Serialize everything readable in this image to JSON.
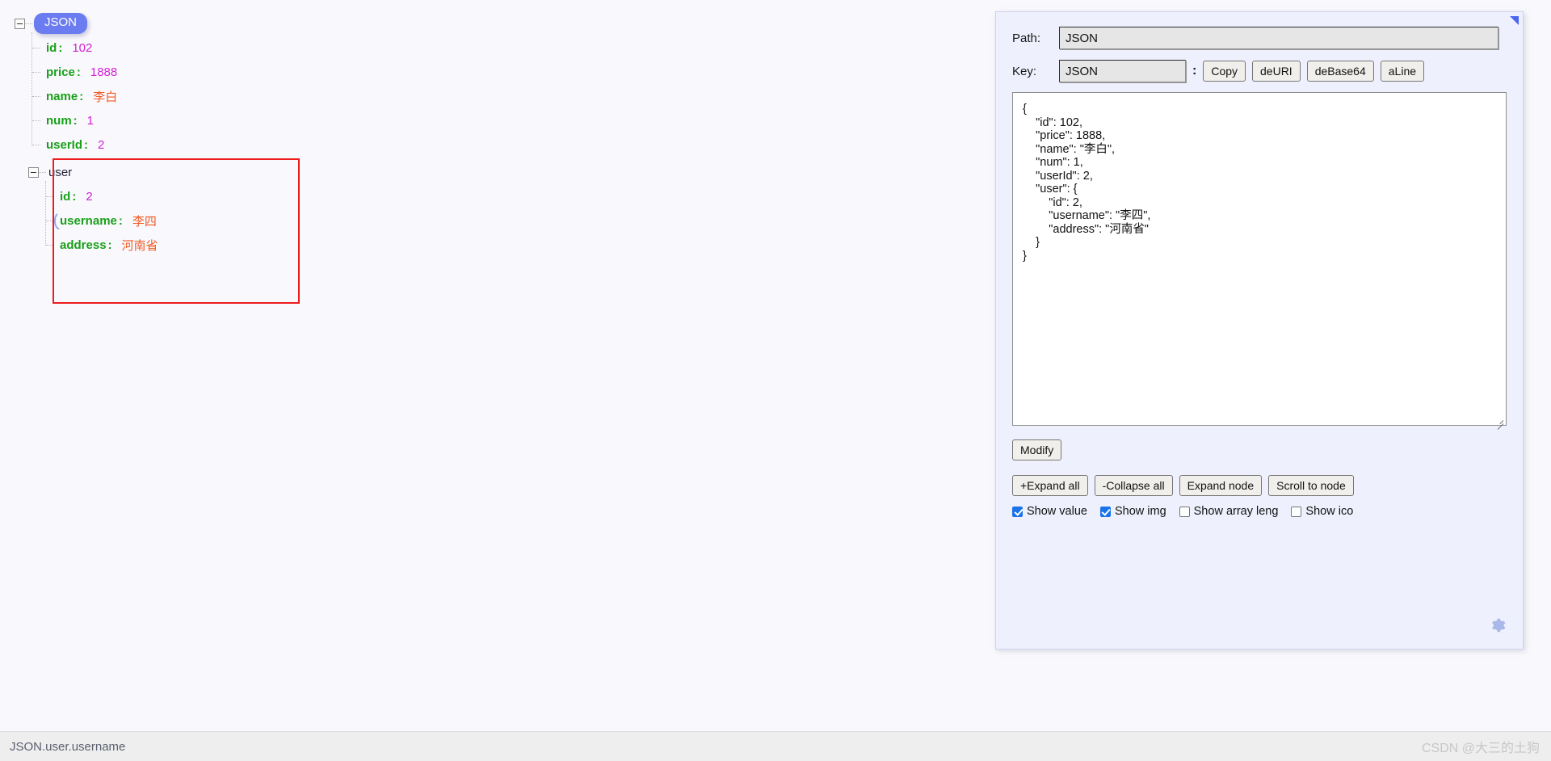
{
  "tree": {
    "root_label": "JSON",
    "nodes": [
      {
        "key": "id",
        "value": "102",
        "type": "number"
      },
      {
        "key": "price",
        "value": "1888",
        "type": "number"
      },
      {
        "key": "name",
        "value": "李白",
        "type": "string"
      },
      {
        "key": "num",
        "value": "1",
        "type": "number"
      },
      {
        "key": "userId",
        "value": "2",
        "type": "number"
      }
    ],
    "object_node": {
      "label": "user",
      "children": [
        {
          "key": "id",
          "value": "2",
          "type": "number",
          "selected": false
        },
        {
          "key": "username",
          "value": "李四",
          "type": "string",
          "selected": true
        },
        {
          "key": "address",
          "value": "河南省",
          "type": "string",
          "selected": false
        }
      ]
    },
    "colors": {
      "key": "#19a019",
      "number": "#d421d4",
      "string": "#f15a24",
      "root_pill_bg": "#6b7bf0",
      "highlight_box": "#ee1c1c",
      "selection_arc": "#9aa7f0"
    }
  },
  "panel": {
    "path": {
      "label": "Path:",
      "value": "JSON"
    },
    "key": {
      "label": "Key:",
      "value": "JSON",
      "separator": ":"
    },
    "key_buttons": [
      {
        "label": "Copy"
      },
      {
        "label": "deURI"
      },
      {
        "label": "deBase64"
      },
      {
        "label": "aLine"
      }
    ],
    "editor": {
      "value": "{\n    \"id\": 102,\n    \"price\": 1888,\n    \"name\": \"李白\",\n    \"num\": 1,\n    \"userId\": 2,\n    \"user\": {\n        \"id\": 2,\n        \"username\": \"李四\",\n        \"address\": \"河南省\"\n    }\n}"
    },
    "modify_button": {
      "label": "Modify"
    },
    "action_buttons": [
      {
        "label": "+Expand all"
      },
      {
        "label": "-Collapse all"
      },
      {
        "label": "Expand node"
      },
      {
        "label": "Scroll to node"
      }
    ],
    "checkboxes": [
      {
        "label": "Show value",
        "checked": true
      },
      {
        "label": "Show img",
        "checked": true
      },
      {
        "label": "Show array leng",
        "checked": false
      },
      {
        "label": "Show ico",
        "checked": false
      }
    ],
    "settings_icon": "gear-icon",
    "resize_corner_icon": "resize-corner-icon"
  },
  "status": {
    "path_text": "JSON.user.username",
    "watermark": "CSDN @大三的土狗"
  }
}
